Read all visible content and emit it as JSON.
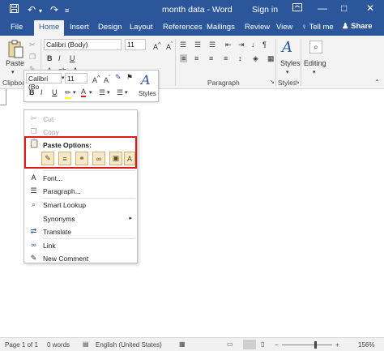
{
  "titlebar": {
    "title": "month data  -  Word",
    "signin": "Sign in",
    "save_icon": "save-icon",
    "undo_icon": "undo-icon",
    "redo_icon": "redo-icon",
    "restore_icon": "ribbon-display-icon",
    "minimize": "—",
    "maximize": "□",
    "close": "✕"
  },
  "tabs": {
    "file": "File",
    "home": "Home",
    "insert": "Insert",
    "design": "Design",
    "layout": "Layout",
    "references": "References",
    "mailings": "Mailings",
    "review": "Review",
    "view": "View",
    "tellme": "Tell me",
    "share": "Share"
  },
  "ribbon": {
    "paste_label": "Paste",
    "clipboard_group": "Clipboa",
    "font_name": "Calibri (Body)",
    "font_size": "11",
    "paragraph_group": "Paragraph",
    "styles_label": "Styles",
    "styles_group": "Styles",
    "editing_label": "Editing"
  },
  "minibar": {
    "font_name": "Calibri (Bo",
    "font_size": "11",
    "bold": "B",
    "italic": "I",
    "underline": "U",
    "styles_label": "Styles"
  },
  "context_menu": {
    "cut": "Cut",
    "copy": "Copy",
    "paste_options": "Paste Options:",
    "font": "Font...",
    "paragraph": "Paragraph...",
    "smart_lookup": "Smart Lookup",
    "synonyms": "Synonyms",
    "translate": "Translate",
    "link": "Link",
    "new_comment": "New Comment"
  },
  "statusbar": {
    "page": "Page 1 of 1",
    "words": "0 words",
    "language": "English (United States)",
    "zoom": "156%",
    "zoom_minus": "−",
    "zoom_plus": "+"
  },
  "colors": {
    "accent": "#2b579a",
    "highlight_border": "#e01a1a"
  }
}
